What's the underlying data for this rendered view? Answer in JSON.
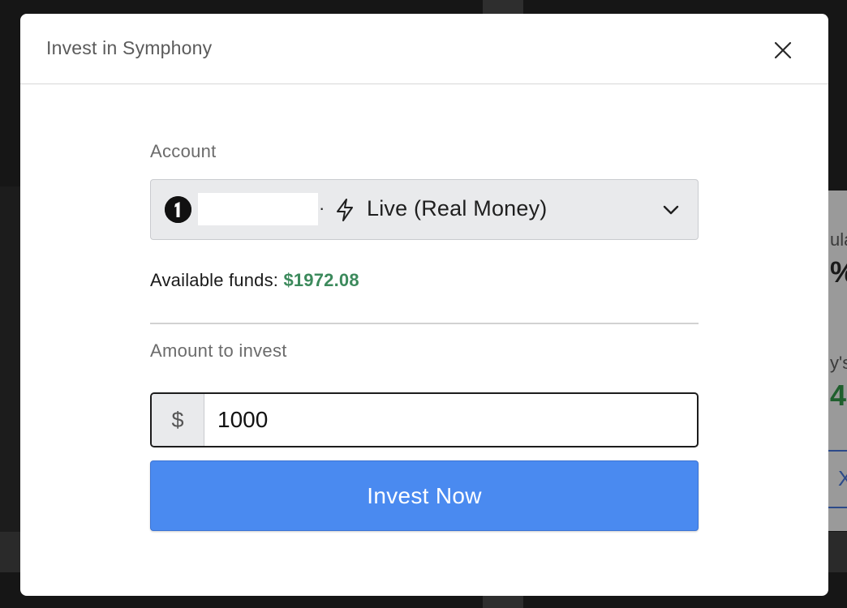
{
  "background": {
    "right_panel_fragments": [
      "ula",
      "%",
      "y's",
      "4",
      "X"
    ]
  },
  "modal": {
    "title": "Invest in Symphony",
    "close_icon": "close-icon"
  },
  "account": {
    "label": "Account",
    "broker_logo_icon": "broker-logo-icon",
    "separator": "·",
    "mode_icon": "lightning-bolt-icon",
    "selected_value": "Live (Real Money)",
    "dropdown_icon": "chevron-down-icon"
  },
  "funds": {
    "label": "Available funds:",
    "value": "$1972.08",
    "value_color": "#3c8a5c"
  },
  "amount": {
    "label": "Amount to invest",
    "currency_symbol": "$",
    "value": "1000"
  },
  "actions": {
    "invest_label": "Invest Now",
    "invest_color": "#4a8af0"
  }
}
